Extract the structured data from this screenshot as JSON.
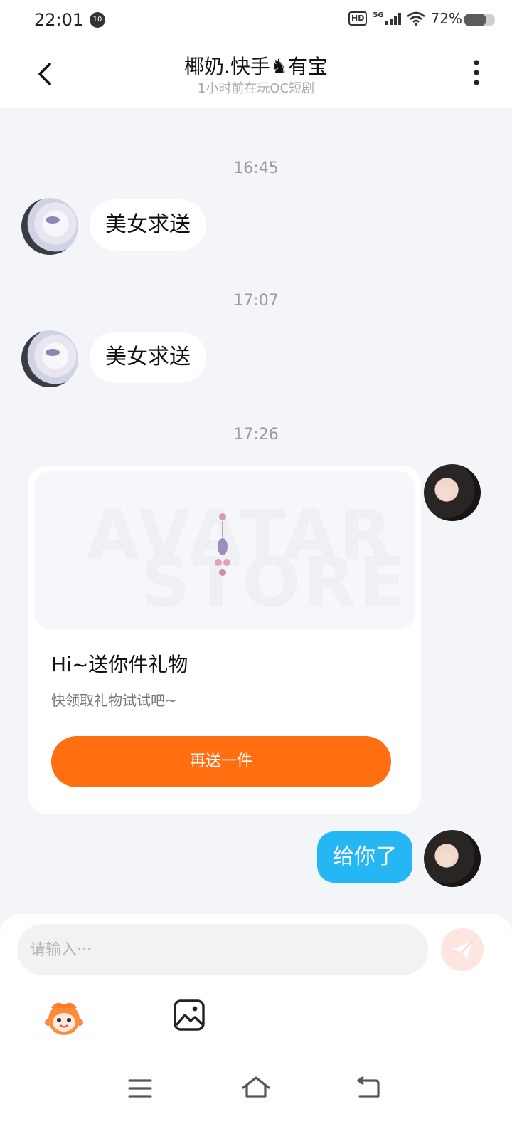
{
  "status_bar": {
    "time": "22:01",
    "notification_count": "10",
    "hd_label": "HD",
    "network": "5G",
    "battery_text": "72%",
    "battery_level": 0.72
  },
  "header": {
    "title": "椰奶.快手♞有宝",
    "subtitle": "1小时前在玩OC短剧"
  },
  "messages": [
    {
      "time": "16:45",
      "text": "美女求送"
    },
    {
      "time": "17:07",
      "text": "美女求送"
    },
    {
      "time": "17:26"
    }
  ],
  "gift_card": {
    "watermark_line1": "AVATAR",
    "watermark_line2": "STORE",
    "title": "Hi~送你件礼物",
    "description": "快领取礼物试试吧~",
    "button_label": "再送一件"
  },
  "outgoing_message": "给你了",
  "composer": {
    "placeholder": "请输入···"
  },
  "icons": {
    "back": "chevron-left-icon",
    "more": "more-vertical-icon",
    "send": "send-icon",
    "emoji": "emoji-icon",
    "image": "image-icon",
    "nav_menu": "menu-icon",
    "nav_home": "home-icon",
    "nav_back": "back-icon"
  },
  "colors": {
    "accent_blue": "#25b7f3",
    "accent_orange": "#ff6f12",
    "background": "#f3f5f8"
  }
}
